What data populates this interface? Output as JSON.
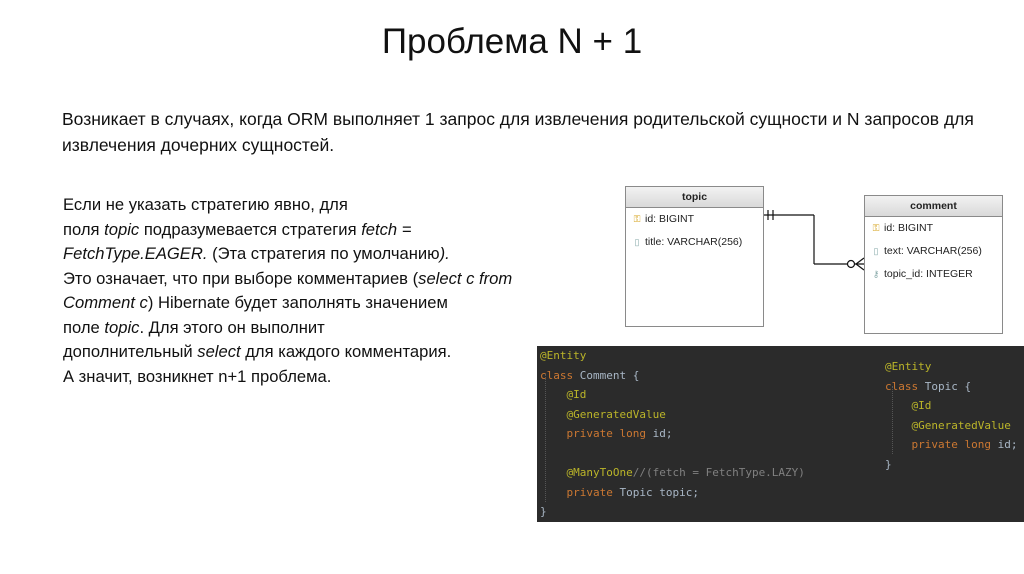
{
  "slide": {
    "title": "Проблема N + 1",
    "intro": "Возникает в случаях, когда ORM выполняет 1 запрос для извлечения родительской сущности и N запросов для извлечения дочерних сущностей.",
    "body_lines": [
      [
        {
          "t": "Если не указать стратегию явно, для",
          "i": false
        }
      ],
      [
        {
          "t": "поля ",
          "i": false
        },
        {
          "t": "topic",
          "i": true
        },
        {
          "t": " подразумевается стратегия ",
          "i": false
        },
        {
          "t": "fetch =",
          "i": true
        }
      ],
      [
        {
          "t": "FetchType.EAGER.",
          "i": true
        },
        {
          "t": " (Эта стратегия по умолчанию",
          "i": false
        },
        {
          "t": ").",
          "i": true
        }
      ],
      [
        {
          "t": "Это означает, что при выборе комментариев (",
          "i": false
        },
        {
          "t": "select c from",
          "i": true
        }
      ],
      [
        {
          "t": "Comment c",
          "i": true
        },
        {
          "t": ") Hibernate будет заполнять значением",
          "i": false
        }
      ],
      [
        {
          "t": "поле ",
          "i": false
        },
        {
          "t": "topic",
          "i": true
        },
        {
          "t": ". Для этого он выполнит",
          "i": false
        }
      ],
      [
        {
          "t": "дополнительный ",
          "i": false
        },
        {
          "t": "select",
          "i": true
        },
        {
          "t": " для каждого комментария.",
          "i": false
        }
      ],
      [
        {
          "t": "А значит, возникнет n+1 проблема.",
          "i": false
        }
      ]
    ]
  },
  "diagram": {
    "topic": {
      "name": "topic",
      "rows": [
        {
          "icon": "key-icon",
          "text": "id: BIGINT"
        },
        {
          "icon": "column-icon",
          "text": "title: VARCHAR(256)"
        }
      ]
    },
    "comment": {
      "name": "comment",
      "rows": [
        {
          "icon": "key-icon",
          "text": "id: BIGINT"
        },
        {
          "icon": "column-icon",
          "text": "text: VARCHAR(256)"
        },
        {
          "icon": "foreign-key-icon",
          "text": "topic_id: INTEGER"
        }
      ]
    }
  },
  "code": {
    "comment_class": [
      [
        {
          "c": "ann",
          "t": "@Entity"
        }
      ],
      [
        {
          "c": "kw",
          "t": "class "
        },
        {
          "c": "plain",
          "t": "Comment {"
        }
      ],
      [
        {
          "c": "plain",
          "t": "    "
        },
        {
          "c": "ann",
          "t": "@Id"
        }
      ],
      [
        {
          "c": "plain",
          "t": "    "
        },
        {
          "c": "ann",
          "t": "@GeneratedValue"
        }
      ],
      [
        {
          "c": "plain",
          "t": "    "
        },
        {
          "c": "kw",
          "t": "private long "
        },
        {
          "c": "plain",
          "t": "id;"
        }
      ],
      [
        {
          "c": "plain",
          "t": ""
        }
      ],
      [
        {
          "c": "plain",
          "t": "    "
        },
        {
          "c": "ann",
          "t": "@ManyToOne"
        },
        {
          "c": "cmt",
          "t": "//(fetch = FetchType.LAZY)"
        }
      ],
      [
        {
          "c": "plain",
          "t": "    "
        },
        {
          "c": "kw",
          "t": "private "
        },
        {
          "c": "plain",
          "t": "Topic topic;"
        }
      ],
      [
        {
          "c": "plain",
          "t": "}"
        }
      ]
    ],
    "topic_class": [
      [
        {
          "c": "ann",
          "t": "@Entity"
        }
      ],
      [
        {
          "c": "kw",
          "t": "class "
        },
        {
          "c": "plain",
          "t": "Topic {"
        }
      ],
      [
        {
          "c": "plain",
          "t": "    "
        },
        {
          "c": "ann",
          "t": "@Id"
        }
      ],
      [
        {
          "c": "plain",
          "t": "    "
        },
        {
          "c": "ann",
          "t": "@GeneratedValue"
        }
      ],
      [
        {
          "c": "plain",
          "t": "    "
        },
        {
          "c": "kw",
          "t": "private long "
        },
        {
          "c": "plain",
          "t": "id;"
        }
      ],
      [
        {
          "c": "plain",
          "t": "}"
        }
      ]
    ]
  }
}
